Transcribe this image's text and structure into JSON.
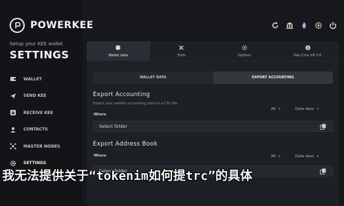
{
  "brand": {
    "name": "POWERKEE"
  },
  "setup_text": "Setup your KEE wallet",
  "page_title": "SETTINGS",
  "nav": [
    {
      "label": "WALLET",
      "icon": "wallet-icon"
    },
    {
      "label": "SEND KEE",
      "icon": "send-icon"
    },
    {
      "label": "RECEIVE KEE",
      "icon": "receive-icon"
    },
    {
      "label": "CONTACTS",
      "icon": "contacts-icon"
    },
    {
      "label": "MASTER NODES",
      "icon": "network-icon"
    },
    {
      "label": "SETTINGS",
      "icon": "gear-icon",
      "active": true
    }
  ],
  "top_icons": [
    "refresh-icon",
    "bank-icon",
    "wallet-flame-icon",
    "settings-icon",
    "power-icon"
  ],
  "tabs": [
    {
      "label": "Wallet data",
      "icon": "database-icon",
      "active": true
    },
    {
      "label": "Tools",
      "icon": "tools-icon"
    },
    {
      "label": "Options",
      "icon": "options-icon"
    },
    {
      "label": "Kee Core V4.3.6",
      "icon": "info-icon"
    }
  ],
  "subtabs": [
    {
      "label": "WALLET DATA"
    },
    {
      "label": "EXPORT ACCOUNTING",
      "active": true
    }
  ],
  "export_accounting": {
    "title": "Export Accounting",
    "description": "Export your wallets accounting data to a CSV file.",
    "where_label": "Where",
    "filter": "All",
    "sort": "Date desc",
    "folder_placeholder": "Select folder"
  },
  "export_address_book": {
    "title": "Export Address Book",
    "where_label": "Where",
    "filter": "All",
    "sort": "Date desc",
    "folder_placeholder": "Select folder"
  },
  "overlay_text": "我无法提供关于“tokenim如何提trc”的具体"
}
